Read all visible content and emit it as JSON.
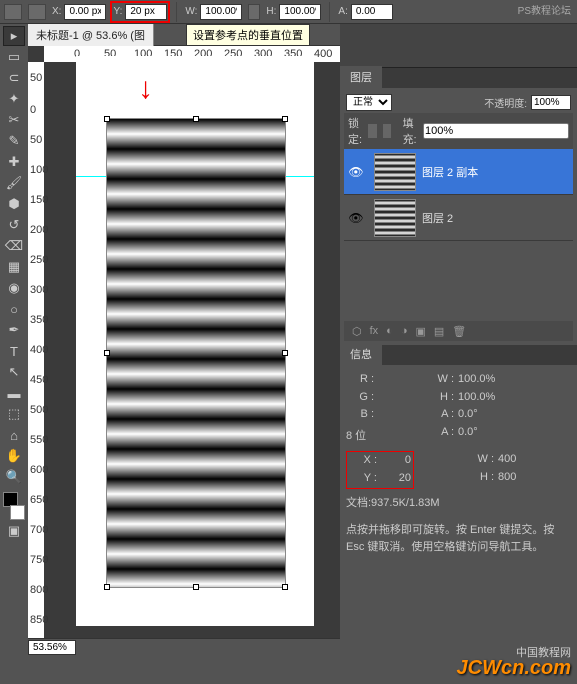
{
  "topbar": {
    "x_label": "X:",
    "x_value": "0.00 px",
    "y_label": "Y:",
    "y_value": "20 px",
    "w_label": "W:",
    "w_value": "100.00%",
    "h_label": "H:",
    "h_value": "100.00%",
    "a_label": "A:",
    "a_value": "0.00"
  },
  "tooltip": "设置参考点的垂直位置",
  "tab": {
    "title": "未标题-1 @ 53.6% (图"
  },
  "ruler_h": [
    "0",
    "50",
    "100",
    "150",
    "200",
    "250",
    "300",
    "350",
    "400"
  ],
  "ruler_v": [
    "50",
    "0",
    "50",
    "100",
    "150",
    "200",
    "250",
    "300",
    "350",
    "400",
    "450",
    "500",
    "550",
    "600",
    "650",
    "700",
    "750",
    "800",
    "850"
  ],
  "status": {
    "zoom": "53.56%"
  },
  "layers_panel": {
    "tab": "图层",
    "blend": "正常",
    "opacity_label": "不透明度:",
    "opacity": "100%",
    "lock_label": "锁定:",
    "fill_label": "填充:",
    "fill": "100%",
    "items": [
      {
        "name": "图层 2 副本",
        "visible": true,
        "selected": true
      },
      {
        "name": "图层 2",
        "visible": true,
        "selected": false
      }
    ]
  },
  "info_panel": {
    "tab": "信息",
    "rgb": {
      "r_label": "R :",
      "g_label": "G :",
      "b_label": "B :"
    },
    "wh": {
      "w_label": "W :",
      "w_val": "100.0%",
      "h_label": "H :",
      "h_val": "100.0%"
    },
    "angle": {
      "a_label": "A :",
      "a_val": "0.0°",
      "d_label": "A :",
      "d_val": "0.0°"
    },
    "bits": "8 位",
    "xy": {
      "x_label": "X :",
      "x_val": "0",
      "y_label": "Y :",
      "y_val": "20"
    },
    "doc_wh": {
      "w_label": "W :",
      "w_val": "400",
      "h_label": "H :",
      "h_val": "800"
    },
    "doc": "文档:937.5K/1.83M",
    "hint": "点按并拖移即可旋转。按 Enter 键提交。按 Esc 键取消。使用空格键访问导航工具。"
  },
  "watermark": "JCWcn.com",
  "wm2": "PS教程论坛",
  "wm3": "中国教程网"
}
